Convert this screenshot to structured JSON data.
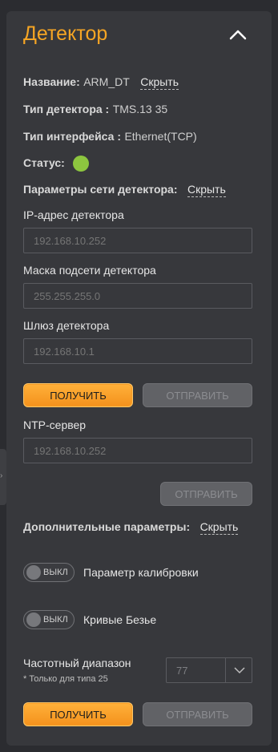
{
  "panel": {
    "title": "Детектор"
  },
  "info": {
    "name_label": "Название:",
    "name_value": "ARM_DT",
    "name_toggle": "Скрыть",
    "type_label": "Тип детектора :",
    "type_value": "TMS.13 35",
    "iface_label": "Тип интерфейса :",
    "iface_value": "Ethernet(TCP)",
    "status_label": "Статус:",
    "status_color": "#8dc63f"
  },
  "network": {
    "section_label": "Параметры сети детектора:",
    "section_toggle": "Скрыть",
    "ip_label": "IP-адрес детектора",
    "ip_placeholder": "192.168.10.252",
    "mask_label": "Маска подсети детектора",
    "mask_placeholder": "255.255.255.0",
    "gateway_label": "Шлюз детектора",
    "gateway_placeholder": "192.168.10.1",
    "get_label": "ПОЛУЧИТЬ",
    "send_label": "ОТПРАВИТЬ",
    "ntp_label": "NTP-сервер",
    "ntp_placeholder": "192.168.10.252",
    "ntp_send_label": "ОТПРАВИТЬ"
  },
  "extra": {
    "section_label": "Дополнительные параметры:",
    "section_toggle": "Скрыть",
    "toggle_off_text": "ВЫКЛ",
    "calibration_label": "Параметр калибровки",
    "bezier_label": "Кривые Безье",
    "freq_label": "Частотный диапазон",
    "freq_note": "* Только для типа 25",
    "freq_value": "77",
    "get_label": "ПОЛУЧИТЬ",
    "send_label": "ОТПРАВИТЬ"
  },
  "colors": {
    "accent": "#f5a524",
    "status_ok": "#8dc63f"
  }
}
